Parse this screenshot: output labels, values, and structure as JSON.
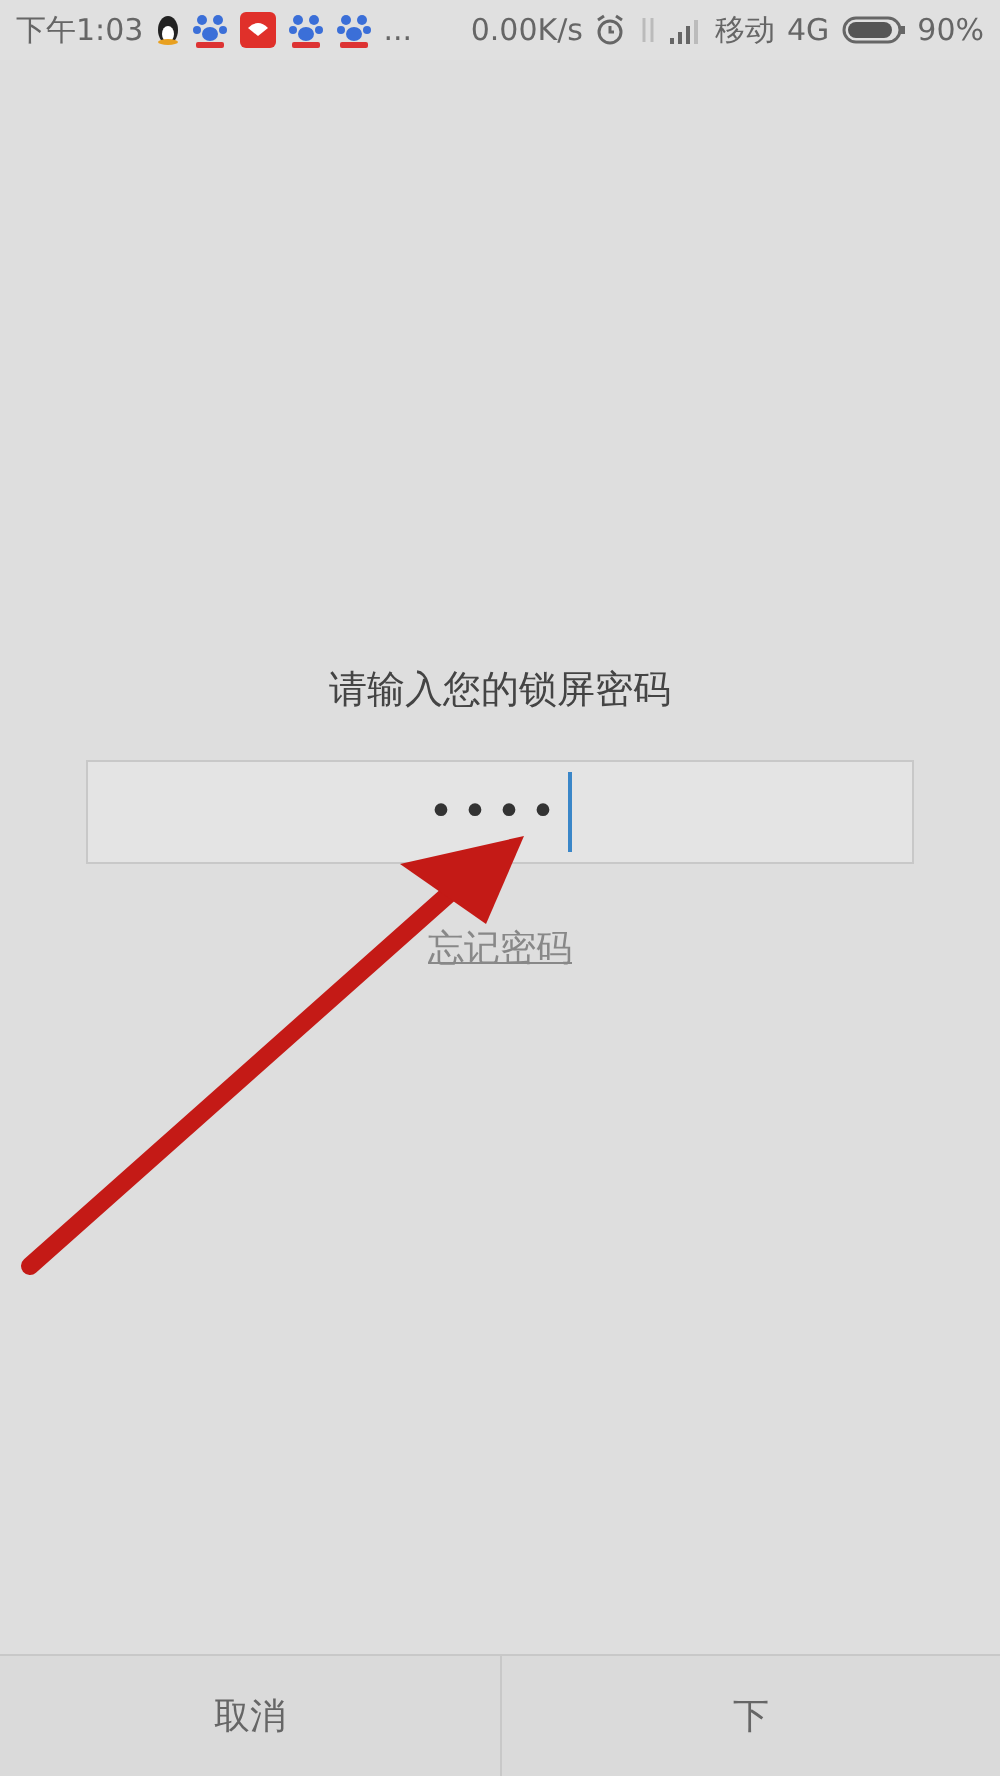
{
  "status_bar": {
    "time": "下午1:03",
    "notifications": [
      {
        "kind": "penguin"
      },
      {
        "kind": "paw"
      },
      {
        "kind": "red-app"
      },
      {
        "kind": "paw"
      },
      {
        "kind": "paw"
      }
    ],
    "more": "...",
    "speed": "0.00K/s",
    "carrier": "移动",
    "network": "4G",
    "battery": "90%"
  },
  "prompt": "请输入您的锁屏密码",
  "password_field": {
    "value": "••••",
    "focused": true
  },
  "forgot_link": "忘记密码",
  "buttons": [
    {
      "label": "取消"
    },
    {
      "label": "下"
    }
  ],
  "annotation": {
    "kind": "arrow"
  }
}
